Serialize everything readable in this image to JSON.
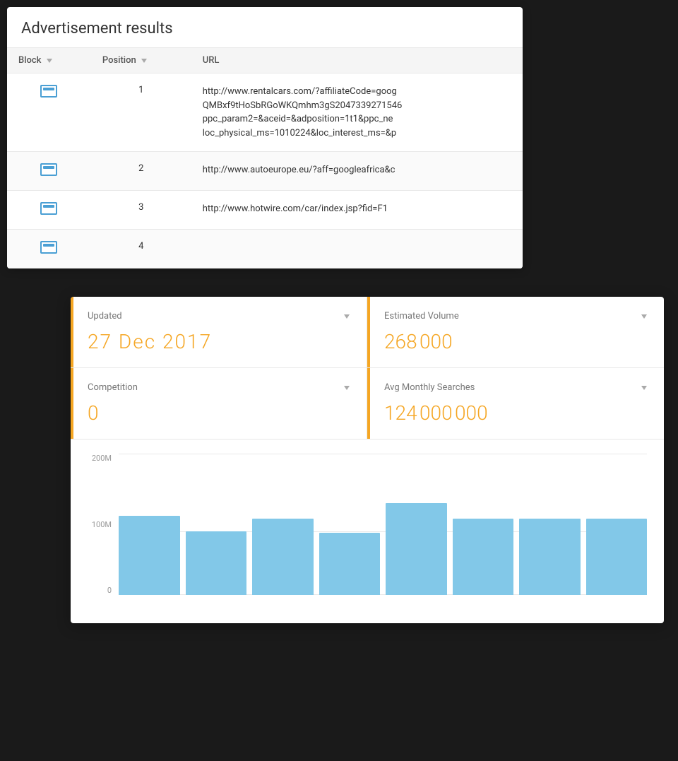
{
  "adResults": {
    "title": "Advertisement results",
    "columns": [
      {
        "label": "Block",
        "sortable": true
      },
      {
        "label": "Position",
        "sortable": true
      },
      {
        "label": "URL",
        "sortable": false
      }
    ],
    "rows": [
      {
        "block": 1,
        "position": 1,
        "url": "http://www.rentalcars.com/?affiliateCode=goog\nQMBxf9tHoSbRGoWKQmhm3gS2047339271546\nppc_param2=&aceid=&adposition=1t1&ppc_ne\nloc_physical_ms=1010224&loc_interest_ms=&p"
      },
      {
        "block": 2,
        "position": 2,
        "url": "http://www.autoeurope.eu/?aff=googleafrica&c"
      },
      {
        "block": 3,
        "position": 3,
        "url": "http://www.hotwire.com/car/index.jsp?fid=F1"
      },
      {
        "block": 4,
        "position": 4,
        "url": ""
      }
    ]
  },
  "stats": {
    "updated": {
      "label": "Updated",
      "value": "27 Dec 2017"
    },
    "estimatedVolume": {
      "label": "Estimated Volume",
      "value": "268 000"
    },
    "competition": {
      "label": "Competition",
      "value": "0"
    },
    "avgMonthlySearches": {
      "label": "Avg Monthly Searches",
      "value": "124 000 000"
    }
  },
  "chart": {
    "yLabels": [
      "200M",
      "100M",
      "0"
    ],
    "barHeights": [
      0.62,
      0.5,
      0.6,
      0.49,
      0.72,
      0.6,
      0.6,
      0.6
    ],
    "barColor": "#82c8e8"
  }
}
